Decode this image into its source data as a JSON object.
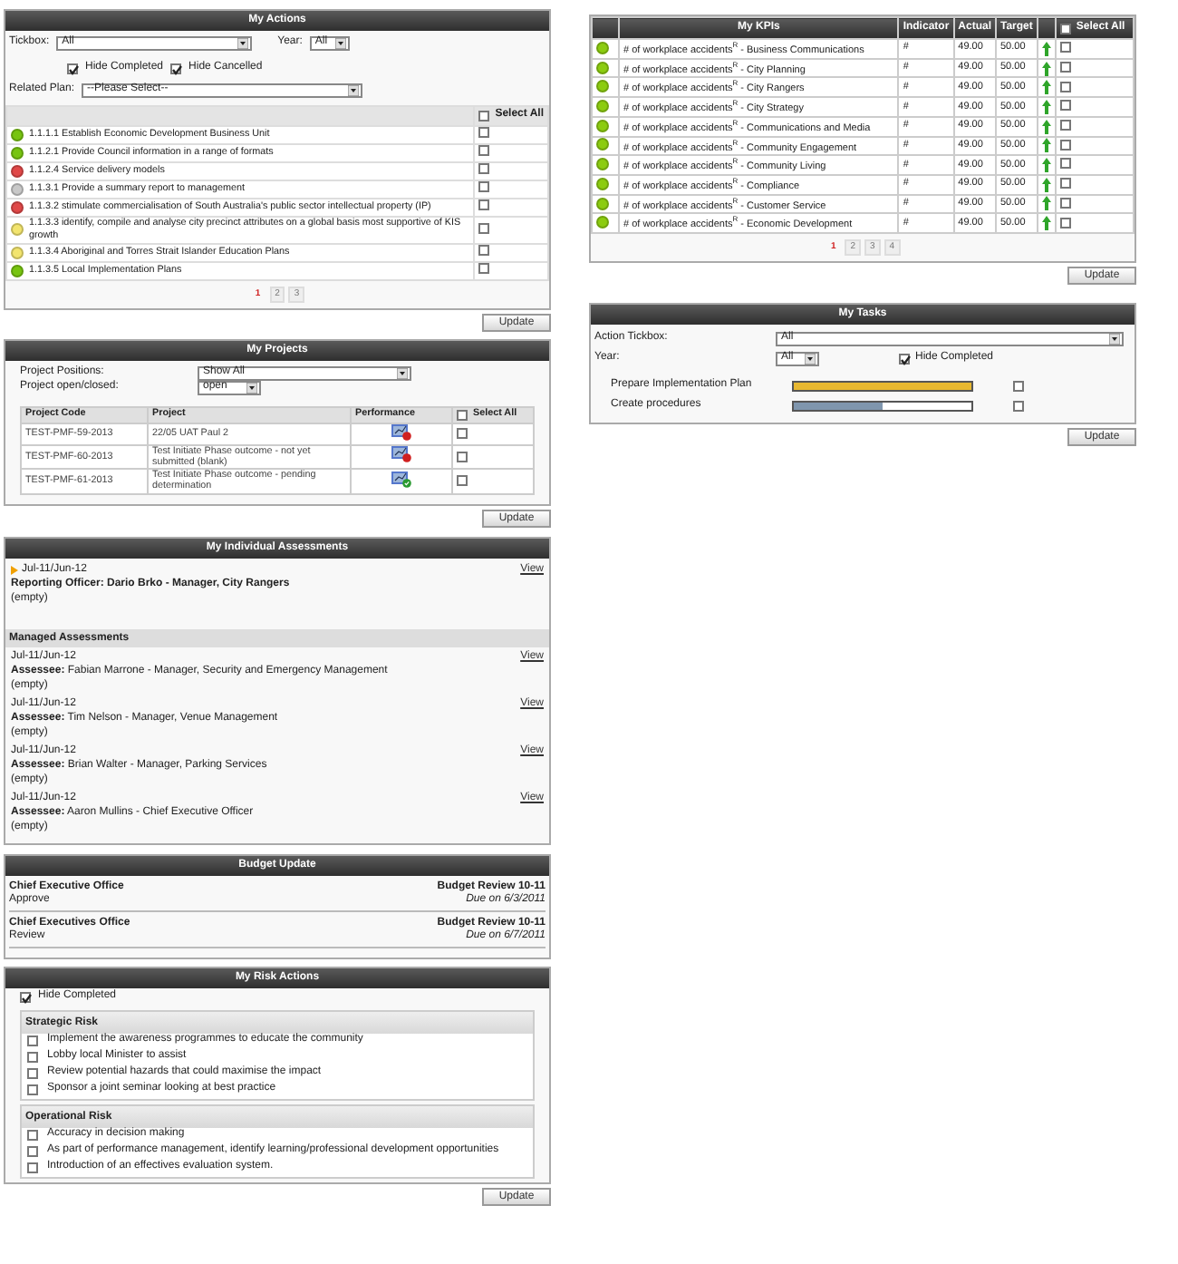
{
  "my_actions": {
    "title": "My Actions",
    "tickbox_label": "Tickbox:",
    "tickbox_value": "All",
    "year_label": "Year:",
    "year_value": "All",
    "hide_completed": {
      "label": "Hide Completed",
      "checked": true
    },
    "hide_cancelled": {
      "label": "Hide Cancelled",
      "checked": true
    },
    "related_plan_label": "Related Plan:",
    "related_plan_value": "--Please Select--",
    "select_all": {
      "label": "Select All",
      "checked": false
    },
    "rows": [
      {
        "text": "1.1.1.1 Establish Economic Development Business Unit",
        "color": "#77c410",
        "checked": false
      },
      {
        "text": "1.1.2.1 Provide Council information in a range of formats",
        "color": "#77c410",
        "checked": false
      },
      {
        "text": "1.1.2.4 Service delivery models",
        "color": "#e04848",
        "checked": false
      },
      {
        "text": "1.1.3.1 Provide a summary report to management",
        "color": "#c8c8c8",
        "checked": false
      },
      {
        "text": "1.1.3.2 stimulate commercialisation of South Australia's public sector intellectual property (IP)",
        "color": "#e04848",
        "checked": false
      },
      {
        "text": "1.1.3.3 identify, compile and analyse city precinct attributes on a global basis most supportive of KIS growth",
        "color": "#f2e46e",
        "checked": false
      },
      {
        "text": "1.1.3.4 Aboriginal and Torres Strait Islander Education Plans",
        "color": "#f2e46e",
        "checked": false
      },
      {
        "text": "1.1.3.5 Local Implementation Plans",
        "color": "#77c410",
        "checked": false
      }
    ],
    "pages": [
      {
        "label": "1",
        "selected": true
      },
      {
        "label": "2",
        "selected": false
      },
      {
        "label": "3",
        "selected": false
      }
    ],
    "update": "Update"
  },
  "my_projects": {
    "title": "My Projects",
    "positions_label": "Project Positions:",
    "positions_value": "Show All",
    "open_label": "Project open/closed:",
    "open_value": "open",
    "columns": [
      "Project Code",
      "Project",
      "Performance"
    ],
    "select_all": {
      "label": "Select All",
      "checked": false
    },
    "rows": [
      {
        "code": "TEST-PMF-59-2013",
        "project": "22/05 UAT Paul 2",
        "kind": "alert",
        "checked": false
      },
      {
        "code": "TEST-PMF-60-2013",
        "project": "Test Initiate Phase outcome - not yet submitted (blank)",
        "kind": "alert",
        "checked": false
      },
      {
        "code": "TEST-PMF-61-2013",
        "project": "Test Initiate Phase outcome - pending determination",
        "kind": "ok",
        "checked": false
      }
    ],
    "update": "Update"
  },
  "assessments": {
    "title": "My Individual Assessments",
    "own": {
      "period": "Jul-11/Jun-12",
      "officer": "Reporting Officer: Dario Brko - Manager, City Rangers",
      "comment": "(empty)",
      "link": "View"
    },
    "managed_title": "Managed Assessments",
    "managed": [
      {
        "period": "Jul-11/Jun-12",
        "assessee": "**Assessee:** Fabian Marrone - Manager, Security and Emergency Management",
        "comment": "(empty)",
        "link": "View"
      },
      {
        "period": "Jul-11/Jun-12",
        "assessee": "**Assessee:** Tim Nelson - Manager, Venue Management",
        "comment": "(empty)",
        "link": "View"
      },
      {
        "period": "Jul-11/Jun-12",
        "assessee": "**Assessee:** Brian Walter - Manager, Parking Services",
        "comment": "(empty)",
        "link": "View"
      },
      {
        "period": "Jul-11/Jun-12",
        "assessee": "**Assessee:** Aaron Mullins - Chief Executive Officer",
        "comment": "(empty)",
        "link": "View"
      }
    ]
  },
  "budget": {
    "title": "Budget Update",
    "items": [
      {
        "office": "Chief Executive Office",
        "action": "Approve",
        "review": "Budget Review 10-11",
        "due": "Due on 6/3/2011"
      },
      {
        "office": "Chief Executives Office",
        "action": "Review",
        "review": "Budget Review 10-11",
        "due": "Due on 6/7/2011"
      }
    ]
  },
  "risk": {
    "title": "My Risk Actions",
    "hide_completed": {
      "label": "Hide Completed",
      "checked": true
    },
    "groups": [
      {
        "title": "Strategic Risk",
        "items": [
          {
            "text": "Implement the awareness programmes to educate the community",
            "checked": false
          },
          {
            "text": "Lobby local Minister to assist",
            "checked": false
          },
          {
            "text": "Review potential hazards that could maximise the impact",
            "checked": false
          },
          {
            "text": "Sponsor a joint seminar looking at best practice",
            "checked": false
          }
        ]
      },
      {
        "title": "Operational Risk",
        "items": [
          {
            "text": "Accuracy in decision making",
            "checked": false
          },
          {
            "text": "As part of performance management, identify learning/professional development opportunities",
            "checked": false
          },
          {
            "text": "Introduction of an effectives evaluation system.",
            "checked": false
          }
        ]
      }
    ],
    "update": "Update"
  },
  "kpis": {
    "title": "My KPIs",
    "columns": [
      "Indicator",
      "Actual",
      "Target"
    ],
    "select_all": {
      "label": "Select All",
      "checked": false
    },
    "rows": [
      {
        "name": "# of workplace accidents$^{R}$ - Business Communications",
        "color": "#8ccc10",
        "indicator": "#",
        "actual": "49.00",
        "target": "50.00",
        "checked": false
      },
      {
        "name": "# of workplace accidents$^{R}$ - City Planning",
        "color": "#8ccc10",
        "indicator": "#",
        "actual": "49.00",
        "target": "50.00",
        "checked": false
      },
      {
        "name": "# of workplace accidents$^{R}$ - City Rangers",
        "color": "#8ccc10",
        "indicator": "#",
        "actual": "49.00",
        "target": "50.00",
        "checked": false
      },
      {
        "name": "# of workplace accidents$^{R}$ - City Strategy",
        "color": "#8ccc10",
        "indicator": "#",
        "actual": "49.00",
        "target": "50.00",
        "checked": false
      },
      {
        "name": "# of workplace accidents$^{R}$ - Communications and Media",
        "color": "#8ccc10",
        "indicator": "#",
        "actual": "49.00",
        "target": "50.00",
        "checked": false
      },
      {
        "name": "# of workplace accidents$^{R}$ - Community Engagement",
        "color": "#8ccc10",
        "indicator": "#",
        "actual": "49.00",
        "target": "50.00",
        "checked": false
      },
      {
        "name": "# of workplace accidents$^{R}$ - Community Living",
        "color": "#8ccc10",
        "indicator": "#",
        "actual": "49.00",
        "target": "50.00",
        "checked": false
      },
      {
        "name": "# of workplace accidents$^{R}$ - Compliance",
        "color": "#8ccc10",
        "indicator": "#",
        "actual": "49.00",
        "target": "50.00",
        "checked": false
      },
      {
        "name": "# of workplace accidents$^{R}$ - Customer Service",
        "color": "#8ccc10",
        "indicator": "#",
        "actual": "49.00",
        "target": "50.00",
        "checked": false
      },
      {
        "name": "# of workplace accidents$^{R}$ - Economic Development",
        "color": "#8ccc10",
        "indicator": "#",
        "actual": "49.00",
        "target": "50.00",
        "checked": false
      }
    ],
    "pages": [
      {
        "label": "1",
        "selected": true
      },
      {
        "label": "2",
        "selected": false
      },
      {
        "label": "3",
        "selected": false
      },
      {
        "label": "4",
        "selected": false
      }
    ],
    "update": "Update"
  },
  "tasks": {
    "title": "My Tasks",
    "tickbox_label": "Action Tickbox:",
    "tickbox_value": "All",
    "year_label": "Year:",
    "year_value": "All",
    "hide_completed": {
      "label": "Hide Completed",
      "checked": true
    },
    "items": [
      {
        "name": "Prepare Implementation Plan",
        "level": 1,
        "color": "#e8b830",
        "checked": false
      },
      {
        "name": "Create procedures",
        "level": 0.5,
        "color": "#7f96ae",
        "checked": false
      }
    ],
    "update": "Update"
  }
}
